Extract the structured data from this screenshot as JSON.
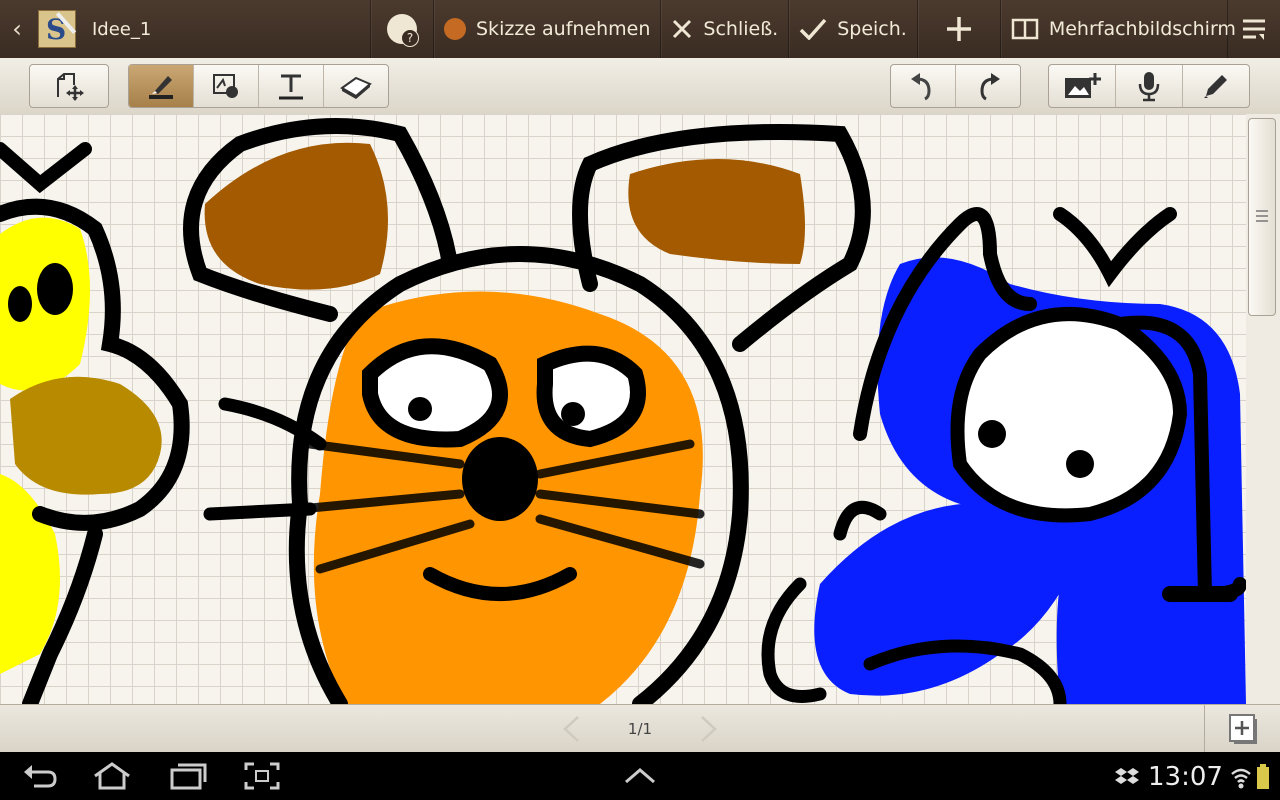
{
  "actionbar": {
    "title": "Idee_1",
    "record_label": "Skizze aufnehmen",
    "close_label": "Schließ.",
    "save_label": "Speich.",
    "multiscreen_label": "Mehrfachbildschirm"
  },
  "pagebar": {
    "page_indicator": "1/1"
  },
  "statusbar": {
    "time": "13:07"
  },
  "colors": {
    "actionbar_bg": "#3f3026",
    "toolbar_bg": "#e8e4da",
    "active_tool": "#b48c55",
    "record_dot": "#c46a22",
    "grid_paper": "#f7f4ee",
    "drawing_orange": "#ff9500",
    "drawing_brown": "#a35a00",
    "drawing_blue": "#0a1fff",
    "drawing_yellow": "#ffff00",
    "drawing_olive": "#b88a00"
  }
}
